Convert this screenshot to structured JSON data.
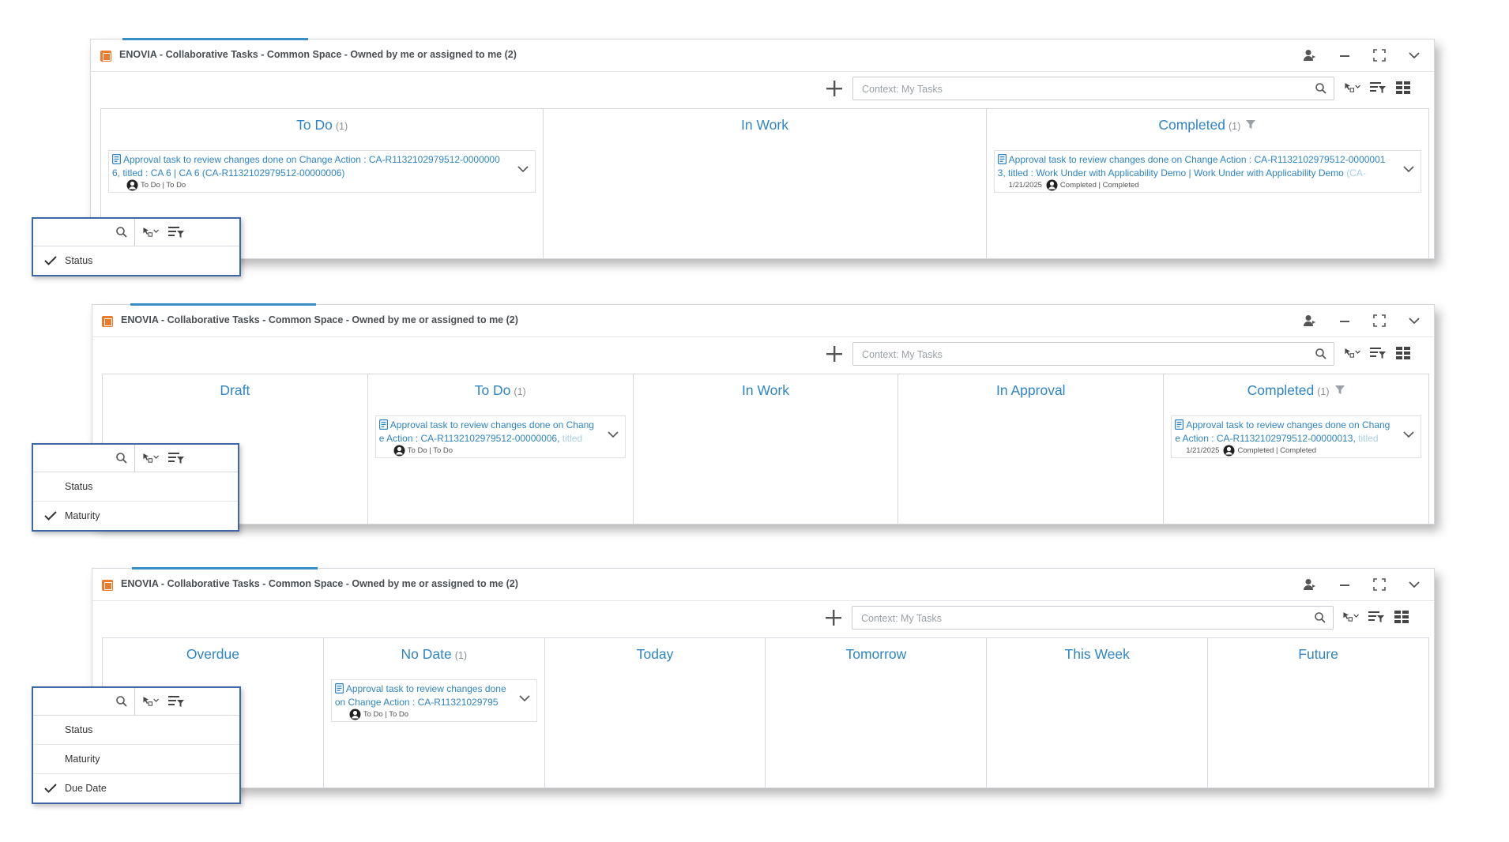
{
  "panels": [
    {
      "title": "ENOVIA - Collaborative Tasks - Common Space - Owned by me or assigned to me (2)",
      "search_placeholder": "Context: My Tasks",
      "columns": [
        {
          "label": "To Do",
          "count": "(1)",
          "filter": false
        },
        {
          "label": "In Work",
          "count": "",
          "filter": false
        },
        {
          "label": "Completed",
          "count": "(1)",
          "filter": true
        }
      ]
    },
    {
      "title": "ENOVIA - Collaborative Tasks - Common Space - Owned by me or assigned to me (2)",
      "search_placeholder": "Context: My Tasks",
      "columns": [
        {
          "label": "Draft",
          "count": "",
          "filter": false
        },
        {
          "label": "To Do",
          "count": "(1)",
          "filter": false
        },
        {
          "label": "In Work",
          "count": "",
          "filter": false
        },
        {
          "label": "In Approval",
          "count": "",
          "filter": false
        },
        {
          "label": "Completed",
          "count": "(1)",
          "filter": true
        }
      ]
    },
    {
      "title": "ENOVIA - Collaborative Tasks - Common Space - Owned by me or assigned to me (2)",
      "search_placeholder": "Context: My Tasks",
      "columns": [
        {
          "label": "Overdue",
          "count": "",
          "filter": false
        },
        {
          "label": "No Date",
          "count": "(1)",
          "filter": false
        },
        {
          "label": "Today",
          "count": "",
          "filter": false
        },
        {
          "label": "Tomorrow",
          "count": "",
          "filter": false
        },
        {
          "label": "This Week",
          "count": "",
          "filter": false
        },
        {
          "label": "Future",
          "count": "",
          "filter": false
        }
      ]
    }
  ],
  "cards": [
    {
      "panel": 0,
      "col": 0,
      "line1": "Approval task to review changes done on Change Action : CA-R1132102979512-0000000",
      "line2": "6, titled : CA 6 | CA 6 (CA-R1132102979512-00000006)",
      "line2_fade": "",
      "date": "",
      "status": "To Do | To Do"
    },
    {
      "panel": 0,
      "col": 2,
      "line1": "Approval task to review changes done on Change Action : CA-R1132102979512-0000001",
      "line2": "3, titled : Work Under with Applicability Demo | Work Under with Applicability Demo",
      "line2_fade": "(CA-",
      "date": "1/21/2025",
      "status": "Completed | Completed"
    },
    {
      "panel": 1,
      "col": 1,
      "line1": "Approval task to review changes done on Chang",
      "line2": "e Action : CA-R1132102979512-00000006,",
      "line2_fade": "titled",
      "date": "",
      "status": "To Do | To Do"
    },
    {
      "panel": 1,
      "col": 4,
      "line1": "Approval task to review changes done on Chang",
      "line2": "e Action : CA-R1132102979512-00000013,",
      "line2_fade": "titled",
      "date": "1/21/2025",
      "status": "Completed | Completed"
    },
    {
      "panel": 2,
      "col": 1,
      "line1": "Approval task to review changes done",
      "line2": "on Change Action : CA-R11321029795",
      "line2_fade": "",
      "date": "",
      "status": "To Do | To Do"
    }
  ],
  "filter_boxes": [
    {
      "options": [
        {
          "label": "Status",
          "checked": true
        }
      ]
    },
    {
      "options": [
        {
          "label": "Status",
          "checked": false
        },
        {
          "label": "Maturity",
          "checked": true
        }
      ]
    },
    {
      "options": [
        {
          "label": "Status",
          "checked": false
        },
        {
          "label": "Maturity",
          "checked": false
        },
        {
          "label": "Due Date",
          "checked": true
        }
      ]
    }
  ],
  "colors": {
    "accent": "#2f85c2",
    "logo": "#ec7b2c",
    "filter_border": "#3f67a6"
  }
}
